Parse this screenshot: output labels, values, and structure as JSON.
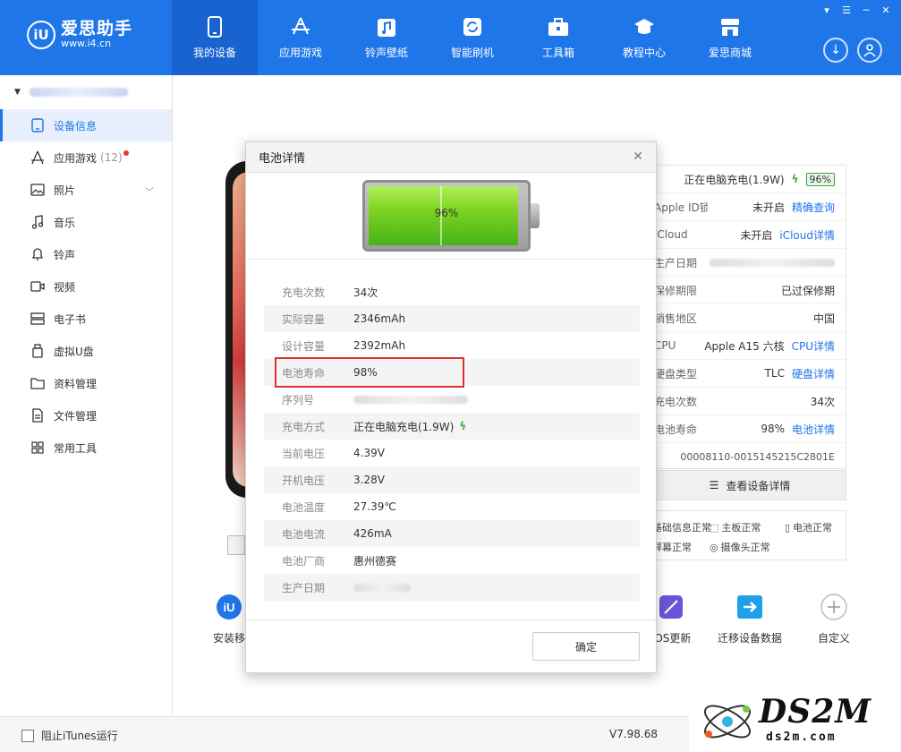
{
  "app": {
    "logo_mark": "iU",
    "name": "爱思助手",
    "url": "www.i4.cn",
    "version": "V7.98.68"
  },
  "nav": [
    {
      "label": "我的设备",
      "icon": "phone-icon",
      "active": true
    },
    {
      "label": "应用游戏",
      "icon": "app-store-icon"
    },
    {
      "label": "铃声壁纸",
      "icon": "music-note-icon"
    },
    {
      "label": "智能刷机",
      "icon": "refresh-icon"
    },
    {
      "label": "工具箱",
      "icon": "toolbox-icon"
    },
    {
      "label": "教程中心",
      "icon": "graduation-cap-icon"
    },
    {
      "label": "爱思商城",
      "icon": "shop-icon"
    }
  ],
  "sidebar": {
    "items": [
      {
        "label": "设备信息",
        "icon": "device-info-icon",
        "active": true
      },
      {
        "label": "应用游戏",
        "count": "(12)",
        "icon": "app-icon",
        "dot": true
      },
      {
        "label": "照片",
        "icon": "photo-icon",
        "expandable": true
      },
      {
        "label": "音乐",
        "icon": "music-icon"
      },
      {
        "label": "铃声",
        "icon": "bell-icon"
      },
      {
        "label": "视频",
        "icon": "video-icon"
      },
      {
        "label": "电子书",
        "icon": "ebook-icon"
      },
      {
        "label": "虚拟U盘",
        "icon": "usb-icon"
      },
      {
        "label": "资料管理",
        "icon": "folder-icon"
      },
      {
        "label": "文件管理",
        "icon": "file-icon"
      },
      {
        "label": "常用工具",
        "icon": "grid-icon"
      }
    ]
  },
  "statusbar": {
    "itunes_label": "阻止iTunes运行"
  },
  "info_panel": {
    "charging": "正在电脑充电(1.9W)",
    "battery_badge": "96%",
    "rows": [
      {
        "label": "Apple ID锁",
        "value": "未开启",
        "link": "精确查询"
      },
      {
        "label": "iCloud",
        "value": "未开启",
        "link": "iCloud详情"
      },
      {
        "label": "生产日期",
        "value": "",
        "blurred": true
      },
      {
        "label": "保修期限",
        "value": "已过保修期"
      },
      {
        "label": "销售地区",
        "value": "中国"
      },
      {
        "label": "CPU",
        "value": "Apple A15 六核",
        "link": "CPU详情"
      },
      {
        "label": "硬盘类型",
        "value": "TLC",
        "link": "硬盘详情"
      },
      {
        "label": "充电次数",
        "value": "34次"
      },
      {
        "label": "电池寿命",
        "value": "98%",
        "link": "电池详情"
      },
      {
        "label": "",
        "value": "00008110-0015145215C2801E"
      }
    ],
    "view_detail": "查看设备详情",
    "diagnostics": [
      "基础信息正常",
      "主板正常",
      "电池正常",
      "屏幕正常",
      "摄像头正常"
    ]
  },
  "tools": [
    {
      "label": "安装移",
      "icon": "install-icon"
    },
    {
      "label": "iOS更新",
      "icon": "ios-update-icon"
    },
    {
      "label": "迁移设备数据",
      "icon": "migrate-icon"
    },
    {
      "label": "自定义",
      "icon": "add-icon"
    }
  ],
  "modal": {
    "title": "电池详情",
    "battery_percent": "96%",
    "battery_level": 0.96,
    "details": [
      {
        "label": "充电次数",
        "value": "34次"
      },
      {
        "label": "实际容量",
        "value": "2346mAh"
      },
      {
        "label": "设计容量",
        "value": "2392mAh"
      },
      {
        "label": "电池寿命",
        "value": "98%",
        "highlighted": true
      },
      {
        "label": "序列号",
        "value": "",
        "blurred": true
      },
      {
        "label": "充电方式",
        "value": "正在电脑充电(1.9W)",
        "bolt": true
      },
      {
        "label": "当前电压",
        "value": "4.39V"
      },
      {
        "label": "开机电压",
        "value": "3.28V"
      },
      {
        "label": "电池温度",
        "value": "27.39℃"
      },
      {
        "label": "电池电流",
        "value": "426mA"
      },
      {
        "label": "电池厂商",
        "value": "惠州德赛"
      },
      {
        "label": "生产日期",
        "value": "",
        "blurred": true
      }
    ],
    "ok_label": "确定"
  },
  "watermark": {
    "text": "DS2M",
    "sub": "ds2m.com"
  },
  "colors": {
    "brand_blue": "#1f76e8",
    "nav_active": "#1863d0",
    "link": "#1f76e8",
    "highlight_red": "#e0322e",
    "battery_green": "#7ed321",
    "bolt_green": "#2fb344"
  }
}
